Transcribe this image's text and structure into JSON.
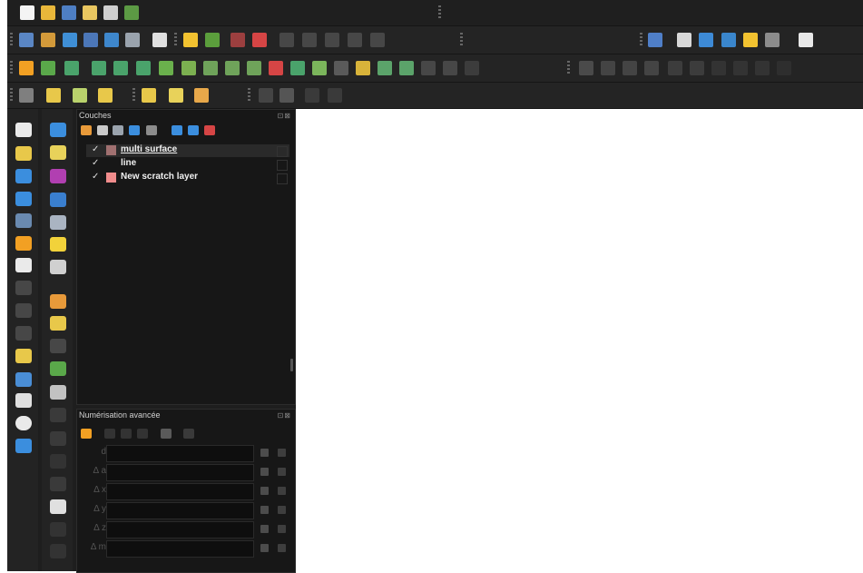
{
  "layers_panel": {
    "title": "Couches",
    "layers": [
      {
        "checked": "✓",
        "name": "multi surface",
        "symbol_color": "#a07070",
        "selected": true
      },
      {
        "checked": "✓",
        "name": "line",
        "symbol_color": "#1e1e1e",
        "selected": false
      },
      {
        "checked": "✓",
        "name": "New scratch layer",
        "symbol_color": "#f08c8c",
        "selected": false
      }
    ]
  },
  "advanced_digitizing_panel": {
    "title": "Numérisation avancée",
    "fields": [
      {
        "label": "d",
        "value": ""
      },
      {
        "label": "Δ a",
        "value": ""
      },
      {
        "label": "Δ x",
        "value": ""
      },
      {
        "label": "Δ y",
        "value": ""
      },
      {
        "label": "Δ z",
        "value": ""
      },
      {
        "label": "Δ m",
        "value": ""
      }
    ]
  },
  "panel_buttons": "⊡⊠",
  "icons": {
    "toolbar_file": [
      "new-project-icon",
      "open-project-icon",
      "save-project-icon",
      "save-as-icon",
      "print-layout-icon",
      "style-manager-icon"
    ],
    "map_nav_left": [
      "pan-icon",
      "pan-to-selection-icon",
      "zoom-in-icon",
      "zoom-out-icon",
      "zoom-full-icon",
      "zoom-to-layer-icon",
      "zoom-to-selection-icon",
      "zoom-last-icon",
      "zoom-next-icon",
      "new-map-view-icon",
      "new-bookmark-icon",
      "show-bookmarks-icon",
      "temporal-controller-icon",
      "refresh-icon"
    ],
    "map_tools_left": [
      "identify-icon",
      "attribute-table-icon",
      "statistics-icon",
      "field-calculator-icon",
      "measure-icon",
      "map-tips-icon",
      "select-feature-icon",
      "edit-pencil-icon",
      "toggle-editing-icon",
      "save-edits-icon",
      "add-feature-icon",
      "vertex-tool-icon",
      "modify-attributes-icon",
      "delete-icon",
      "cut-icon",
      "copy-icon",
      "paste-icon",
      "undo-icon",
      "redo-icon"
    ]
  },
  "colors": {
    "accent_yellow": "#f2c230",
    "accent_green": "#6fb24b",
    "accent_blue": "#3b8ede",
    "accent_red": "#d64545"
  }
}
